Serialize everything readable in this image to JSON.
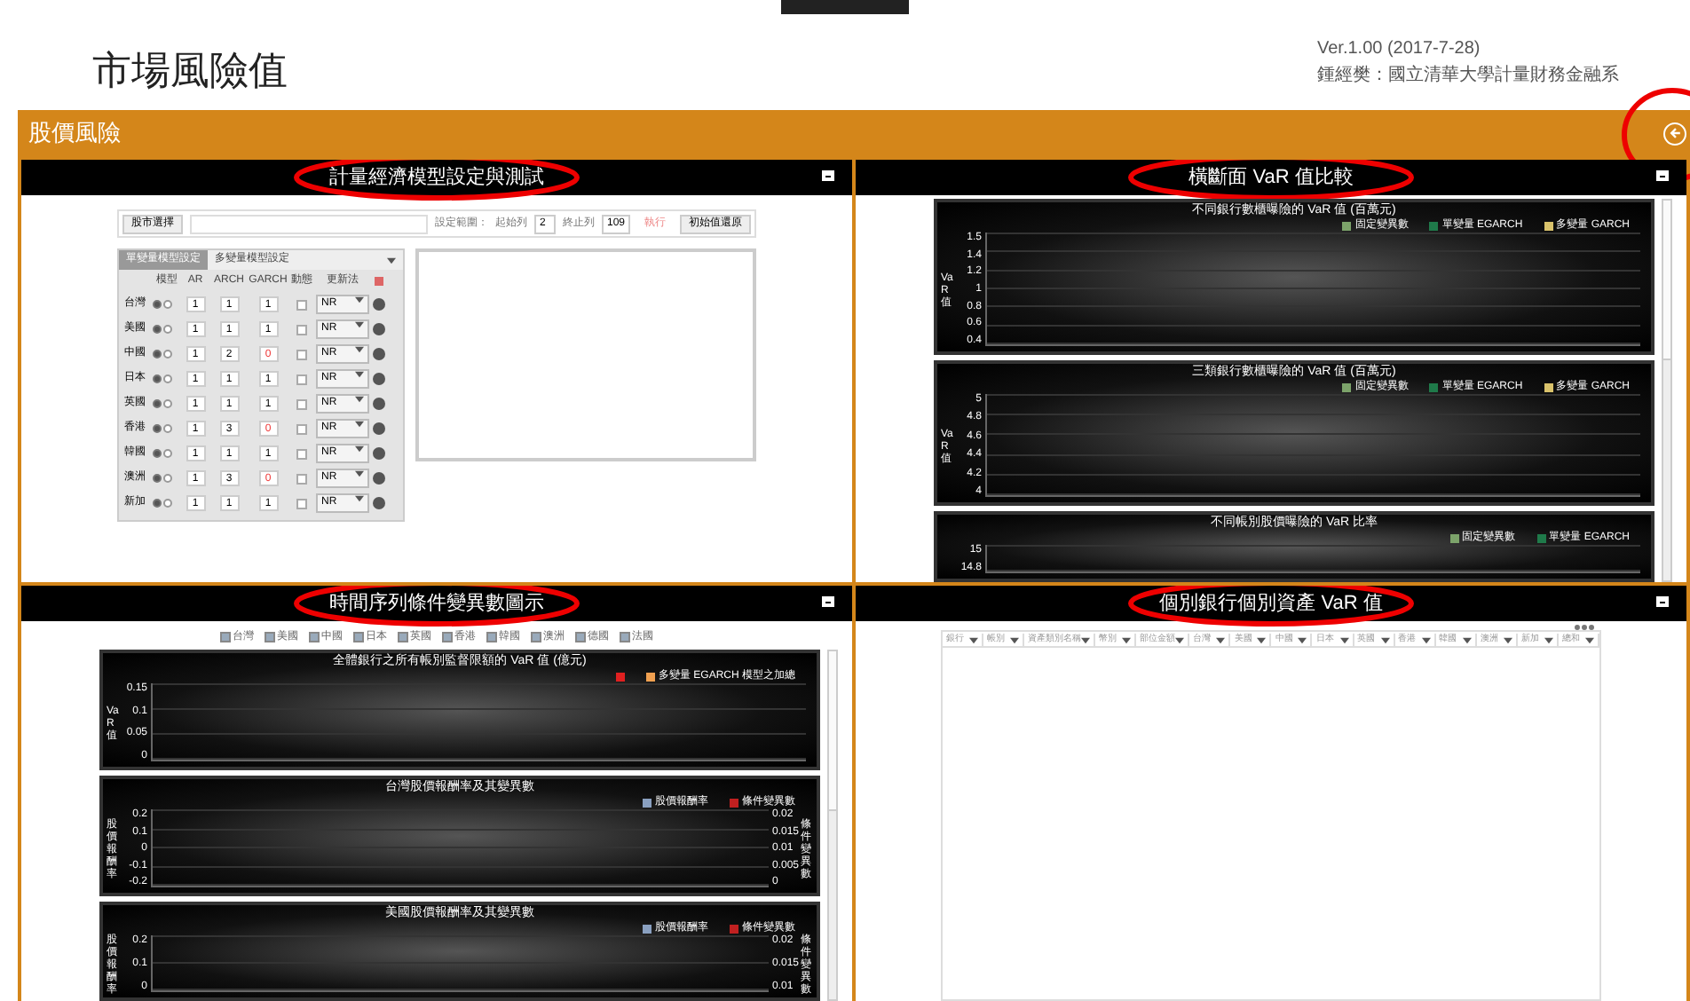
{
  "header": {
    "title": "市場風險值",
    "version": "Ver.1.00 (2017-7-28)",
    "author": "鍾經樊：國立清華大學計量財務金融系"
  },
  "section": {
    "title": "股價風險"
  },
  "panels": [
    {
      "kind": "model",
      "title": "計量經濟模型設定與測試",
      "search_label": "股市選擇",
      "range_label": "設定範圍：",
      "from_label": "起始列",
      "from_value": "2",
      "to_label": "終止列",
      "to_value": "109",
      "run_label": "執行",
      "reset_label": "初始值還原",
      "tabs": [
        {
          "label": "單變量模型設定",
          "selected": true
        },
        {
          "label": "多變量模型設定",
          "selected": false
        }
      ],
      "columns": [
        "模型",
        "AR",
        "ARCH",
        "GARCH",
        "動態",
        "更新法"
      ],
      "rows": [
        {
          "market": "台灣",
          "ar": "1",
          "arch": "1",
          "garch": "1",
          "garch_alert": false,
          "checked": false,
          "method": "NR"
        },
        {
          "market": "美國",
          "ar": "1",
          "arch": "1",
          "garch": "1",
          "garch_alert": false,
          "checked": false,
          "method": "NR"
        },
        {
          "market": "中國",
          "ar": "1",
          "arch": "2",
          "garch": "0",
          "garch_alert": true,
          "checked": false,
          "method": "NR"
        },
        {
          "market": "日本",
          "ar": "1",
          "arch": "1",
          "garch": "1",
          "garch_alert": false,
          "checked": false,
          "method": "NR"
        },
        {
          "market": "英國",
          "ar": "1",
          "arch": "1",
          "garch": "1",
          "garch_alert": false,
          "checked": false,
          "method": "NR"
        },
        {
          "market": "香港",
          "ar": "1",
          "arch": "3",
          "garch": "0",
          "garch_alert": true,
          "checked": false,
          "method": "NR"
        },
        {
          "market": "韓國",
          "ar": "1",
          "arch": "1",
          "garch": "1",
          "garch_alert": false,
          "checked": false,
          "method": "NR"
        },
        {
          "market": "澳洲",
          "ar": "1",
          "arch": "3",
          "garch": "0",
          "garch_alert": true,
          "checked": false,
          "method": "NR"
        },
        {
          "market": "新加",
          "ar": "1",
          "arch": "1",
          "garch": "1",
          "garch_alert": false,
          "checked": false,
          "method": "NR"
        }
      ]
    },
    {
      "kind": "charts",
      "title": "橫斷面 VaR 值比較",
      "charts": [
        {
          "title": "不同銀行數櫃曝險的 VaR 值 (百萬元)",
          "ylabel": "VaR 值",
          "yticks": [
            "1.5",
            "1.4",
            "1.2",
            "1",
            "0.8",
            "0.6",
            "0.4"
          ],
          "legend": [
            {
              "label": "固定變異數",
              "color": "#7ca36a"
            },
            {
              "label": "單變量 EGARCH",
              "color": "#1f7a4a"
            },
            {
              "label": "多變量 GARCH",
              "color": "#d9c26b"
            }
          ]
        },
        {
          "title": "三類銀行數櫃曝險的 VaR 值 (百萬元)",
          "ylabel": "VaR 值",
          "yticks": [
            "5",
            "4.8",
            "4.6",
            "4.4",
            "4.2",
            "4"
          ],
          "legend": [
            {
              "label": "固定變異數",
              "color": "#7ca36a"
            },
            {
              "label": "單變量 EGARCH",
              "color": "#1f7a4a"
            },
            {
              "label": "多變量 GARCH",
              "color": "#d9c26b"
            }
          ]
        },
        {
          "title": "不同帳別股價曝險的 VaR 比率",
          "yticks": [
            "15",
            "14.8"
          ],
          "legend": [
            {
              "label": "固定變異數",
              "color": "#7ca36a"
            },
            {
              "label": "單變量 EGARCH",
              "color": "#1f7a4a"
            }
          ]
        }
      ]
    },
    {
      "kind": "charts",
      "title": "時間序列條件變異數圖示",
      "filters": [
        {
          "label": "台灣",
          "checked": true
        },
        {
          "label": "美國",
          "checked": true
        },
        {
          "label": "中國",
          "checked": true
        },
        {
          "label": "日本",
          "checked": true
        },
        {
          "label": "英國",
          "checked": true
        },
        {
          "label": "香港",
          "checked": true
        },
        {
          "label": "韓國",
          "checked": true
        },
        {
          "label": "澳洲",
          "checked": true
        },
        {
          "label": "德國",
          "checked": true
        },
        {
          "label": "法國",
          "checked": true
        }
      ],
      "charts": [
        {
          "title": "全體銀行之所有帳別監督限額的 VaR 值 (億元)",
          "ylabel": "VaR 值",
          "yticks": [
            "0.15",
            "0.1",
            "0.05",
            "0"
          ],
          "legend": [
            {
              "color": "#e02020"
            },
            {
              "label": "多變量 EGARCH 模型之加總",
              "color": "#f0a050"
            }
          ]
        },
        {
          "title": "台灣股價報酬率及其變異數",
          "ylabel": "股價報酬率",
          "yticks": [
            "0.2",
            "0.1",
            "0",
            "-0.1",
            "-0.2"
          ],
          "right_ylabel": "條件變異數",
          "right_yticks": [
            "0.02",
            "0.015",
            "0.01",
            "0.005",
            "0"
          ],
          "legend": [
            {
              "label": "股價報酬率",
              "color": "#8aa0c0"
            },
            {
              "label": "條件變異數",
              "color": "#c02020"
            }
          ]
        },
        {
          "title": "美國股價報酬率及其變異數",
          "ylabel": "股價報酬率",
          "yticks": [
            "0.2",
            "0.1",
            "0"
          ],
          "right_ylabel": "條件變異數",
          "right_yticks": [
            "0.02",
            "0.015",
            "0.01"
          ],
          "legend": [
            {
              "label": "股價報酬率",
              "color": "#8aa0c0"
            },
            {
              "label": "條件變異數",
              "color": "#c02020"
            }
          ]
        }
      ]
    },
    {
      "kind": "table",
      "title": "個別銀行個別資產 VaR 值",
      "columns": [
        "銀行",
        "帳別",
        "資產類別名稱",
        "幣別",
        "部位金額",
        "台灣",
        "美國",
        "中國",
        "日本",
        "英國",
        "香港",
        "韓國",
        "澳洲",
        "新加",
        "總和"
      ]
    }
  ]
}
